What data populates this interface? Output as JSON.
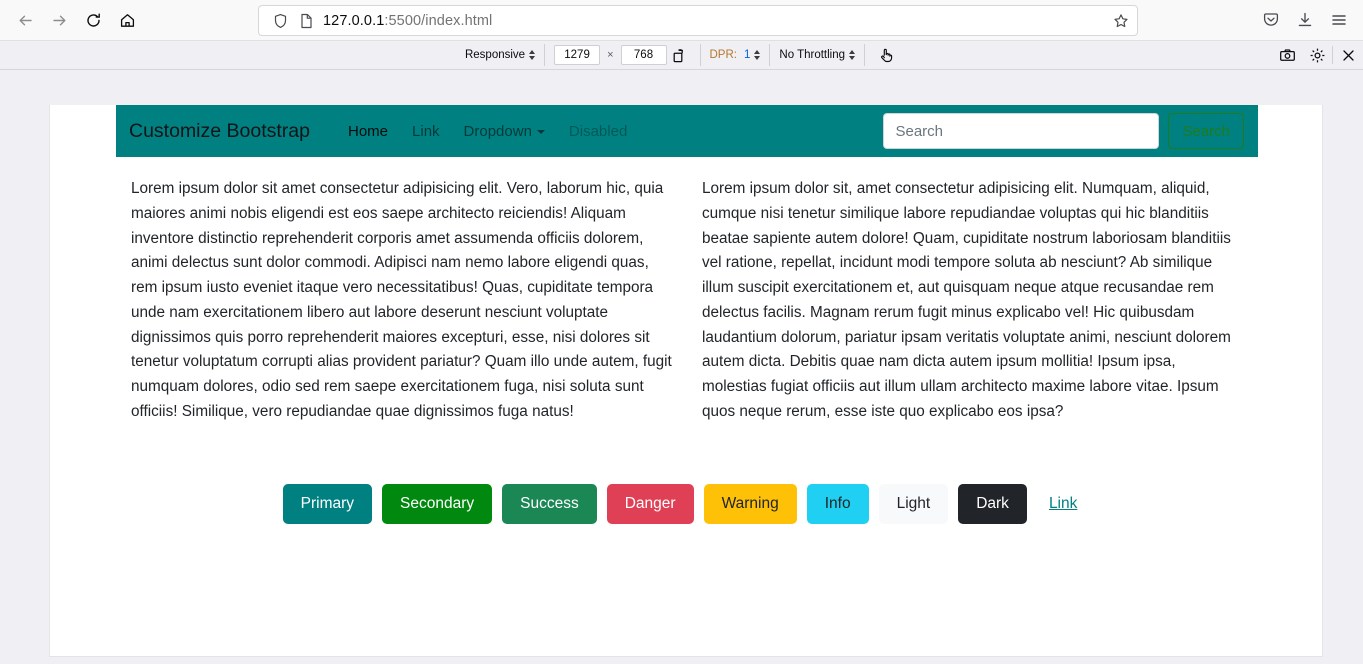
{
  "browser": {
    "back_label": "Back",
    "forward_label": "Forward",
    "reload_label": "Reload",
    "home_label": "Home",
    "url_host": "127.0.0.1",
    "url_path": ":5500/index.html",
    "bookmark_label": "Bookmark this page",
    "pocket_label": "Save to Pocket",
    "downloads_label": "Downloads",
    "menu_label": "Open application menu"
  },
  "devtools": {
    "device_select": "Responsive",
    "width": "1279",
    "height": "768",
    "rotate_label": "Rotate viewport",
    "dpr_label": "DPR:",
    "dpr_value": "1",
    "throttling": "No Throttling",
    "touch_label": "Toggle touch simulation",
    "screenshot_label": "Take a screenshot",
    "settings_label": "Responsive Design Mode settings",
    "close_label": "Close Responsive Design Mode"
  },
  "navbar": {
    "brand": "Customize Bootstrap",
    "links": [
      {
        "label": "Home",
        "state": "active"
      },
      {
        "label": "Link",
        "state": "default"
      },
      {
        "label": "Dropdown",
        "state": "dropdown"
      },
      {
        "label": "Disabled",
        "state": "disabled"
      }
    ],
    "search_placeholder": "Search",
    "search_value": "",
    "search_button": "Search",
    "background_color": "#008080"
  },
  "content": {
    "left_paragraph": "Lorem ipsum dolor sit amet consectetur adipisicing elit. Vero, laborum hic, quia maiores animi nobis eligendi est eos saepe architecto reiciendis! Aliquam inventore distinctio reprehenderit corporis amet assumenda officiis dolorem, animi delectus sunt dolor commodi. Adipisci nam nemo labore eligendi quas, rem ipsum iusto eveniet itaque vero necessitatibus! Quas, cupiditate tempora unde nam exercitationem libero aut labore deserunt nesciunt voluptate dignissimos quis porro reprehenderit maiores excepturi, esse, nisi dolores sit tenetur voluptatum corrupti alias provident pariatur? Quam illo unde autem, fugit numquam dolores, odio sed rem saepe exercitationem fuga, nisi soluta sunt officiis! Similique, vero repudiandae quae dignissimos fuga natus!",
    "right_paragraph": "Lorem ipsum dolor sit, amet consectetur adipisicing elit. Numquam, aliquid, cumque nisi tenetur similique labore repudiandae voluptas qui hic blanditiis beatae sapiente autem dolore! Quam, cupiditate nostrum laboriosam blanditiis vel ratione, repellat, incidunt modi tempore soluta ab nesciunt? Ab similique illum suscipit exercitationem et, aut quisquam neque atque recusandae rem delectus facilis. Magnam rerum fugit minus explicabo vel! Hic quibusdam laudantium dolorum, pariatur ipsam veritatis voluptate animi, nesciunt dolorem autem dicta. Debitis quae nam dicta autem ipsum mollitia! Ipsum ipsa, molestias fugiat officiis aut illum ullam architecto maxime labore vitae. Ipsum quos neque rerum, esse iste quo explicabo eos ipsa?"
  },
  "buttons": [
    {
      "label": "Primary",
      "variant": "primary",
      "color": "#008080"
    },
    {
      "label": "Secondary",
      "variant": "secondary",
      "color": "#00890e"
    },
    {
      "label": "Success",
      "variant": "success",
      "color": "#1a8754"
    },
    {
      "label": "Danger",
      "variant": "danger",
      "color": "#e04055"
    },
    {
      "label": "Warning",
      "variant": "warning",
      "color": "#fec107"
    },
    {
      "label": "Info",
      "variant": "info",
      "color": "#1fd0f3"
    },
    {
      "label": "Light",
      "variant": "light",
      "color": "#f8f9fa"
    },
    {
      "label": "Dark",
      "variant": "dark",
      "color": "#212529"
    },
    {
      "label": "Link",
      "variant": "link",
      "color": "#008080"
    }
  ]
}
